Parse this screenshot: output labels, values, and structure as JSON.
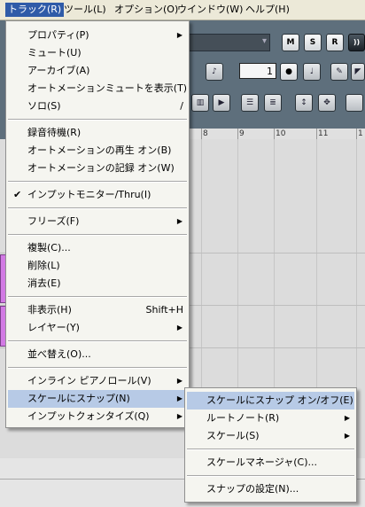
{
  "menubar": {
    "items": [
      {
        "label": "トラック(R)"
      },
      {
        "label": "ツール(L)"
      },
      {
        "label": "オプション(O)"
      },
      {
        "label": "ウインドウ(W)"
      },
      {
        "label": "ヘルプ(H)"
      }
    ]
  },
  "toolbar": {
    "mute_label": "M",
    "solo_label": "S",
    "rec_label": "R",
    "monitor_label": "))",
    "number_value": "1",
    "icons": [
      "speaker-icon",
      "note-icon",
      "note-edit-icon",
      "pencil-icon",
      "paint-icon",
      "grid-icon",
      "select-icon",
      "list-icon",
      "fit-vertical-icon",
      "fit-all-icon"
    ]
  },
  "ruler": {
    "marks": [
      "8",
      "9",
      "10",
      "11",
      "1"
    ]
  },
  "track_menu": {
    "items": [
      {
        "label": "プロパティ(P)",
        "submenu": true
      },
      {
        "label": "ミュート(U)"
      },
      {
        "label": "アーカイブ(A)"
      },
      {
        "label": "オートメーションミュートを表示(T)"
      },
      {
        "label": "ソロ(S)",
        "shortcut": "/"
      },
      {
        "label": "録音待機(R)"
      },
      {
        "label": "オートメーションの再生 オン(B)"
      },
      {
        "label": "オートメーションの記録 オン(W)"
      },
      {
        "label": "インプットモニター/Thru(I)",
        "checked": true
      },
      {
        "label": "フリーズ(F)",
        "submenu": true
      },
      {
        "label": "複製(C)..."
      },
      {
        "label": "削除(L)"
      },
      {
        "label": "消去(E)"
      },
      {
        "label": "非表示(H)",
        "shortcut": "Shift+H"
      },
      {
        "label": "レイヤー(Y)",
        "submenu": true
      },
      {
        "label": "並べ替え(O)..."
      },
      {
        "label": "インライン ピアノロール(V)",
        "submenu": true
      },
      {
        "label": "スケールにスナップ(N)",
        "submenu": true,
        "highlighted": true
      },
      {
        "label": "インプットクォンタイズ(Q)",
        "submenu": true
      }
    ]
  },
  "snap_submenu": {
    "items": [
      {
        "label": "スケールにスナップ オン/オフ(E)",
        "highlighted": true
      },
      {
        "label": "ルートノート(R)",
        "submenu": true
      },
      {
        "label": "スケール(S)",
        "submenu": true
      },
      {
        "label": "スケールマネージャ(C)..."
      },
      {
        "label": "スナップの設定(N)..."
      }
    ]
  },
  "glyphs": {
    "check": "✔",
    "arrow": "▶",
    "dropdown": "▾"
  }
}
